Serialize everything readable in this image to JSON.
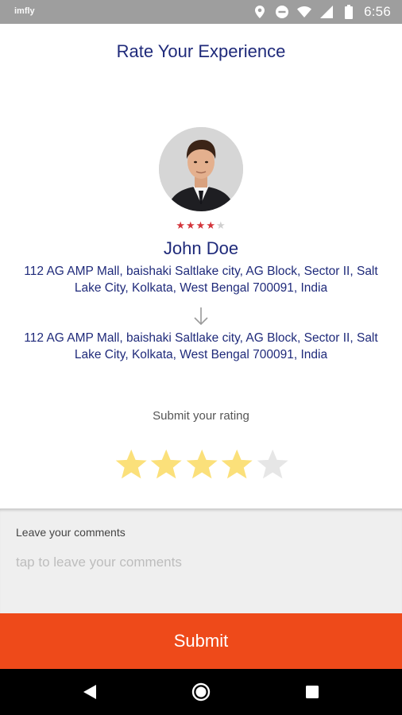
{
  "status_bar": {
    "left_text": "imfly",
    "time": "6:56",
    "icons": [
      "location-icon",
      "do-not-disturb-icon",
      "wifi-icon",
      "signal-icon",
      "battery-icon"
    ]
  },
  "header": {
    "title": "Rate Your Experience"
  },
  "driver": {
    "name": "John Doe",
    "rating_stars": 4,
    "rating_max": 5,
    "from_address": "112 AG AMP Mall, baishaki Saltlake city, AG Block, Sector II, Salt Lake City, Kolkata, West Bengal 700091, India",
    "to_address": "112 AG AMP Mall, baishaki Saltlake city, AG Block, Sector II, Salt Lake City, Kolkata, West Bengal 700091, India"
  },
  "rating": {
    "label": "Submit your rating",
    "selected": 4,
    "max": 5,
    "color_on": "#fbe07a",
    "color_off": "#e6e6e6"
  },
  "comments": {
    "label": "Leave your comments",
    "placeholder": "tap to leave your comments",
    "value": ""
  },
  "submit": {
    "label": "Submit",
    "color": "#ee4a1a"
  },
  "nav": {
    "icons": [
      "back-icon",
      "home-icon",
      "recents-icon"
    ]
  }
}
